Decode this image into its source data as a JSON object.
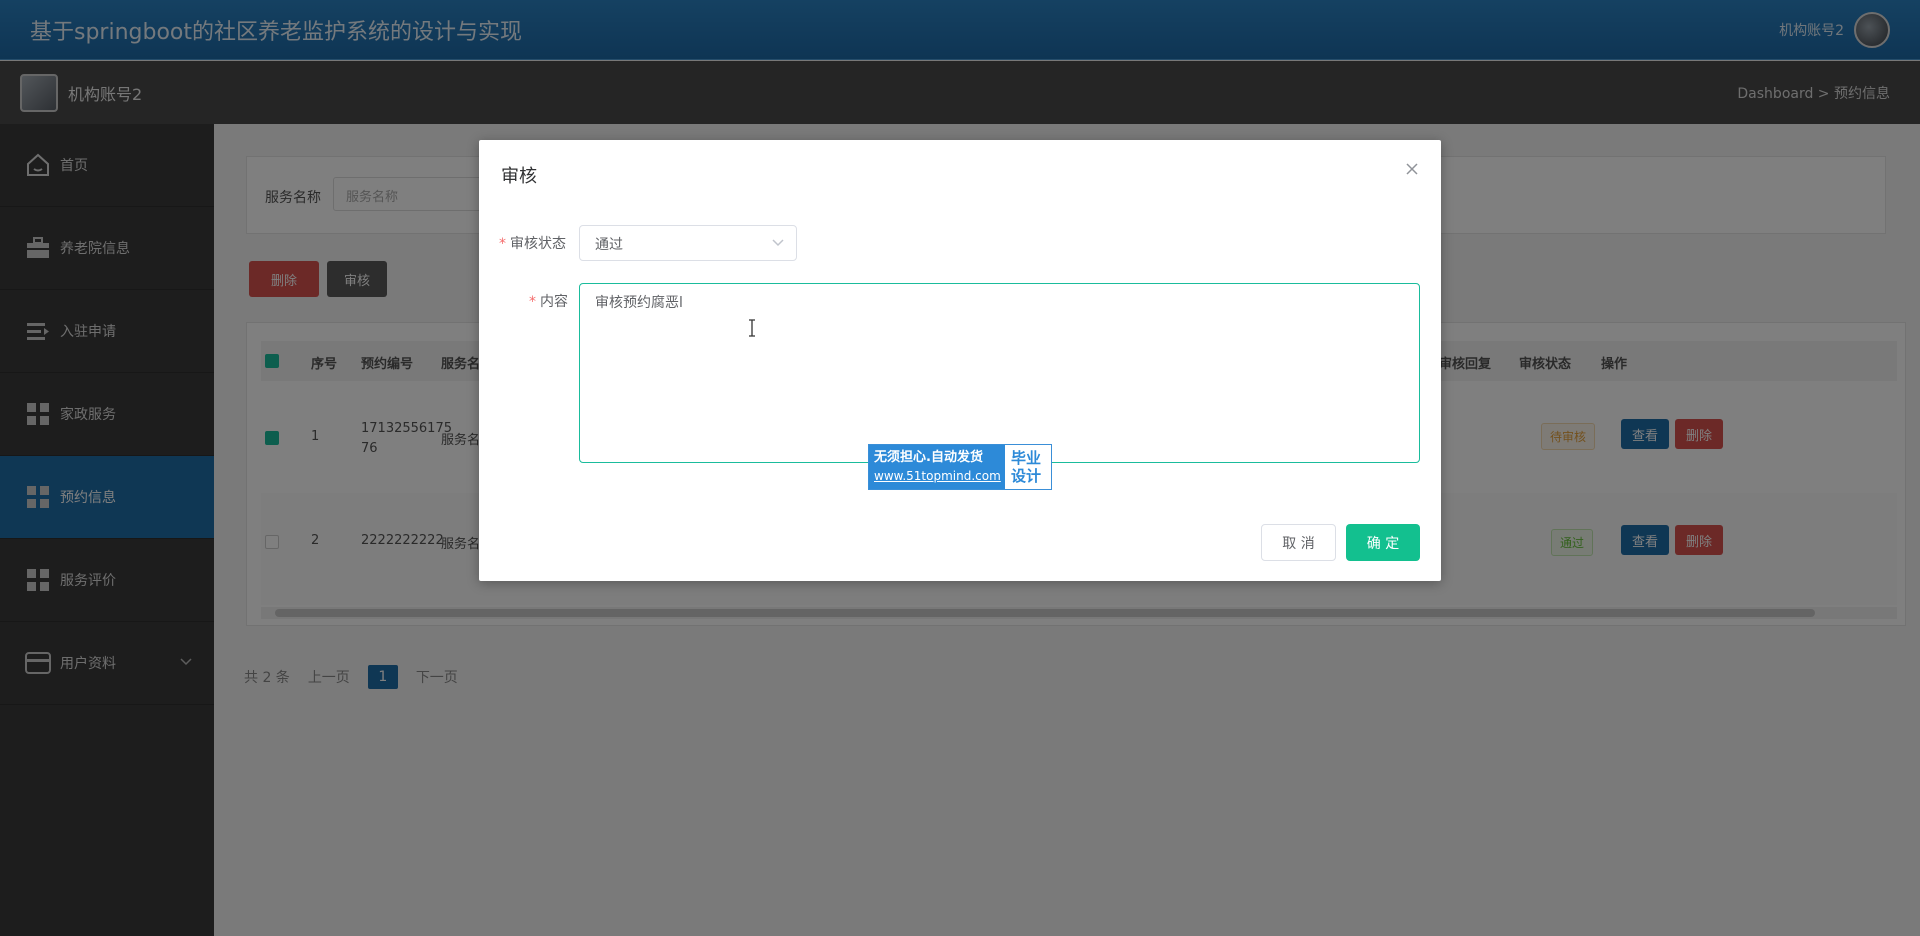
{
  "header": {
    "title": "基于springboot的社区养老监护系统的设计与实现",
    "username": "机构账号2"
  },
  "subbar": {
    "brand": "机构账号2",
    "breadcrumb": "Dashboard > 预约信息"
  },
  "sidebar": {
    "items": [
      {
        "label": "首页",
        "icon": "home-icon"
      },
      {
        "label": "养老院信息",
        "icon": "briefcase-icon"
      },
      {
        "label": "入驻申请",
        "icon": "list-icon"
      },
      {
        "label": "家政服务",
        "icon": "grid-icon"
      },
      {
        "label": "预约信息",
        "icon": "grid-icon",
        "active": true
      },
      {
        "label": "服务评价",
        "icon": "grid-icon"
      },
      {
        "label": "用户资料",
        "icon": "card-icon",
        "expandable": true
      }
    ]
  },
  "search": {
    "label": "服务名称",
    "placeholder": "服务名称"
  },
  "toolbar": {
    "delete_label": "删除",
    "audit_label": "审核"
  },
  "table": {
    "columns": [
      "序号",
      "预约编号",
      "服务名",
      "审核回复",
      "审核状态",
      "操作"
    ],
    "rows": [
      {
        "index": "1",
        "order_no": "17132556175 76",
        "service": "服务名",
        "status": "待审核",
        "checked": true
      },
      {
        "index": "2",
        "order_no": "2222222222",
        "service": "服务名",
        "status": "通过",
        "checked": false
      }
    ],
    "view_label": "查看",
    "delete_label": "删除"
  },
  "pager": {
    "total": "共 2 条",
    "prev": "上一页",
    "current": "1",
    "next": "下一页"
  },
  "dialog": {
    "title": "审核",
    "status_label": "审核状态",
    "status_value": "通过",
    "content_label": "内容",
    "content_value": "审核预约腐恶l",
    "cancel_label": "取 消",
    "confirm_label": "确 定"
  },
  "watermark": {
    "line1": "无须担心.自动发货",
    "line2": "www.51topmind.com",
    "right1": "毕业",
    "right2": "设计"
  },
  "colors": {
    "header": "#1d6aa8",
    "active": "#1f6ea9",
    "confirm": "#13c08f",
    "danger": "#d9534f"
  }
}
